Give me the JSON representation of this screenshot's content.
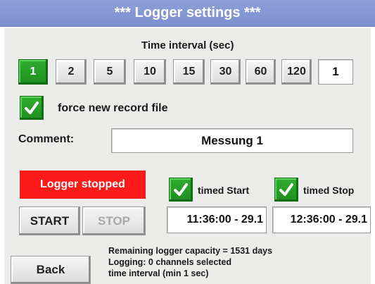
{
  "title": "***   Logger settings   ***",
  "time_interval": {
    "label": "Time interval (sec)",
    "options": [
      "1",
      "2",
      "5",
      "10",
      "15",
      "30",
      "60",
      "120"
    ],
    "selected": "1",
    "custom_value": "1"
  },
  "force_new_record": {
    "checked": true,
    "label": "force new record file"
  },
  "comment": {
    "label": "Comment:",
    "value": "Messung 1"
  },
  "logger": {
    "status": "Logger stopped",
    "status_color": "#ff1a1a",
    "start_label": "START",
    "stop_label": "STOP"
  },
  "timed_start": {
    "checked": true,
    "label": "timed Start",
    "value": "11:36:00 - 29.1"
  },
  "timed_stop": {
    "checked": true,
    "label": "timed Stop",
    "value": "12:36:00 - 29.1"
  },
  "info": {
    "capacity": "Remaining logger capacity = 1531 days",
    "channels": "Logging: 0 channels selected",
    "interval": "time interval (min 1 sec)"
  },
  "back_label": "Back",
  "icons": {
    "check": "checkmark-icon"
  },
  "colors": {
    "title_bar": "#8fa0d8",
    "active_green": "#1f8f1f",
    "panel": "#ececea"
  }
}
